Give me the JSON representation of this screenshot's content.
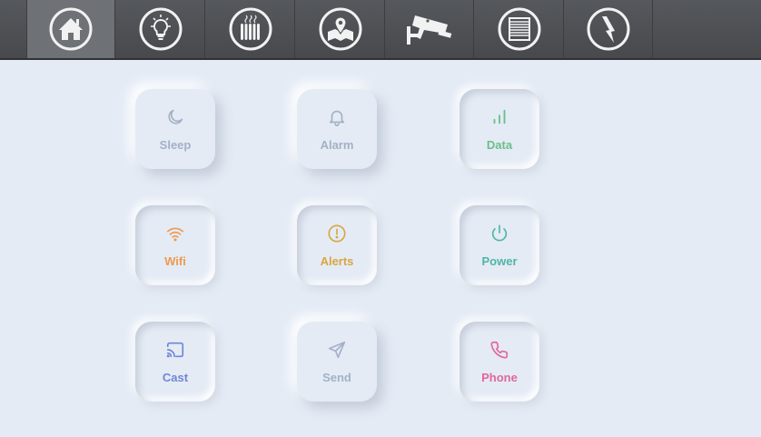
{
  "nav": [
    {
      "icon": "home-icon"
    },
    {
      "icon": "lightbulb-icon"
    },
    {
      "icon": "radiator-icon"
    },
    {
      "icon": "map-pin-icon"
    },
    {
      "icon": "security-camera-icon"
    },
    {
      "icon": "window-blind-icon"
    },
    {
      "icon": "lightning-icon"
    }
  ],
  "tiles": [
    {
      "label": "Sleep",
      "icon": "moon-icon",
      "color": "#a3b1c6"
    },
    {
      "label": "Alarm",
      "icon": "bell-icon",
      "color": "#a3b1c6"
    },
    {
      "label": "Data",
      "icon": "signal-bars-icon",
      "color": "#69c08a"
    },
    {
      "label": "Wifi",
      "icon": "wifi-icon",
      "color": "#ee9a4d"
    },
    {
      "label": "Alerts",
      "icon": "alert-circle-icon",
      "color": "#d9a640"
    },
    {
      "label": "Power",
      "icon": "power-icon",
      "color": "#4fb5a7"
    },
    {
      "label": "Cast",
      "icon": "cast-icon",
      "color": "#6f86d6"
    },
    {
      "label": "Send",
      "icon": "send-icon",
      "color": "#a3b1c6"
    },
    {
      "label": "Phone",
      "icon": "phone-icon",
      "color": "#e2679b"
    }
  ]
}
